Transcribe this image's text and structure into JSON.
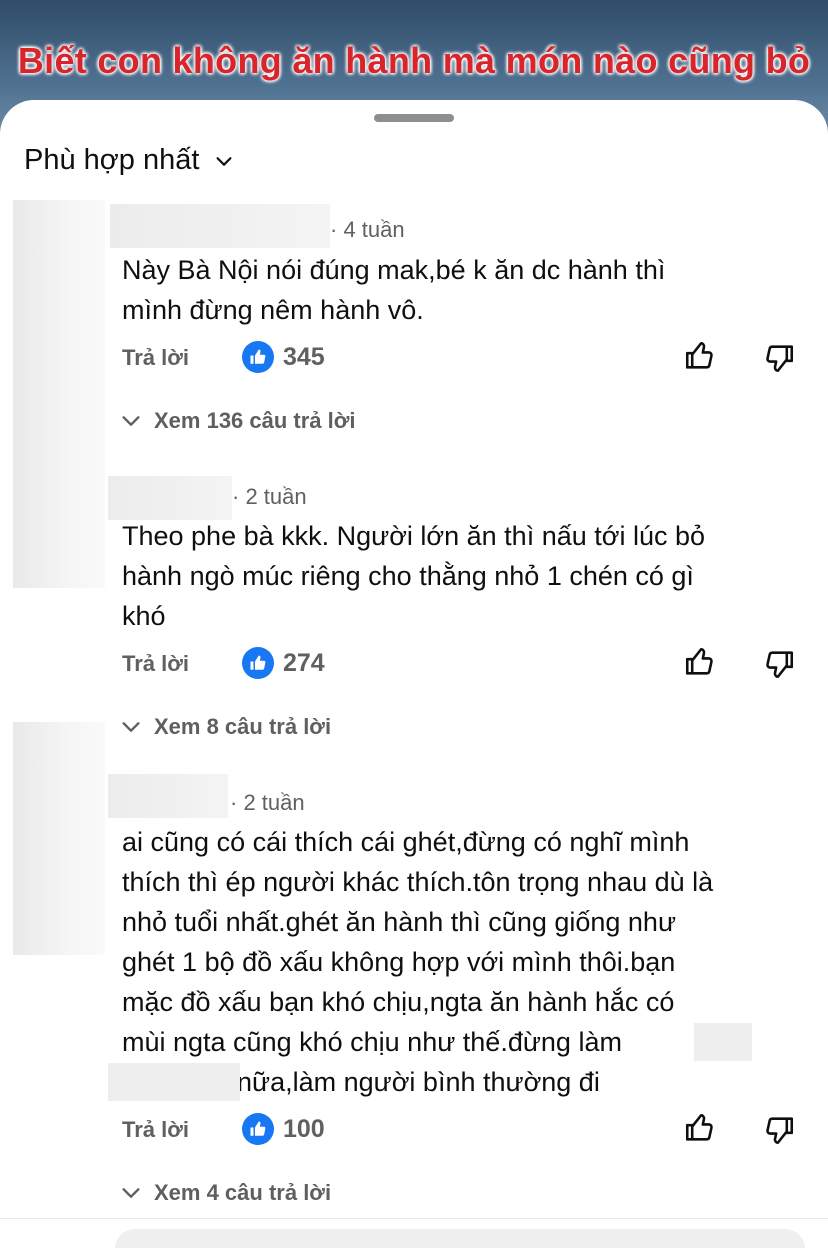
{
  "video": {
    "caption": "Biết con không ăn hành mà món nào cũng bỏ"
  },
  "sort": {
    "label": "Phù hợp nhất",
    "icon": "chevron-down-icon"
  },
  "actions": {
    "reply_label": "Trả lời"
  },
  "colors": {
    "accent": "#1877f2",
    "caption_red": "#d8252b",
    "text": "#0f0f0f",
    "muted": "#606060"
  },
  "comments": [
    {
      "time": "· 4 tuần",
      "lines": [
        "Này Bà Nội nói đúng mak,bé k ăn dc hành thì",
        "mình đừng nêm hành vô."
      ],
      "likes": "345",
      "replies": "Xem 136 câu trả lời"
    },
    {
      "time": "· 2 tuần",
      "lines": [
        "Theo phe bà kkk. Người lớn ăn thì nấu tới lúc bỏ",
        "hành ngò múc riêng cho thằng nhỏ 1 chén có gì",
        "khó"
      ],
      "likes": "274",
      "replies": "Xem 8 câu trả lời"
    },
    {
      "time": "· 2 tuần",
      "lines": [
        "ai cũng có cái thích cái ghét,đừng có nghĩ mình",
        "thích thì ép người khác thích.tôn trọng nhau dù là",
        "nhỏ tuổi nhất.ghét ăn hành thì cũng giống như",
        "ghét 1 bộ đồ xấu không hợp với mình thôi.bạn",
        "mặc đồ xấu bạn khó chịu,ngta ăn hành hắc có",
        "mùi ngta cũng khó chịu như thế.đừng làm",
        "nữa,làm người bình thường đi"
      ],
      "likes": "100",
      "replies": "Xem 4 câu trả lời"
    }
  ]
}
